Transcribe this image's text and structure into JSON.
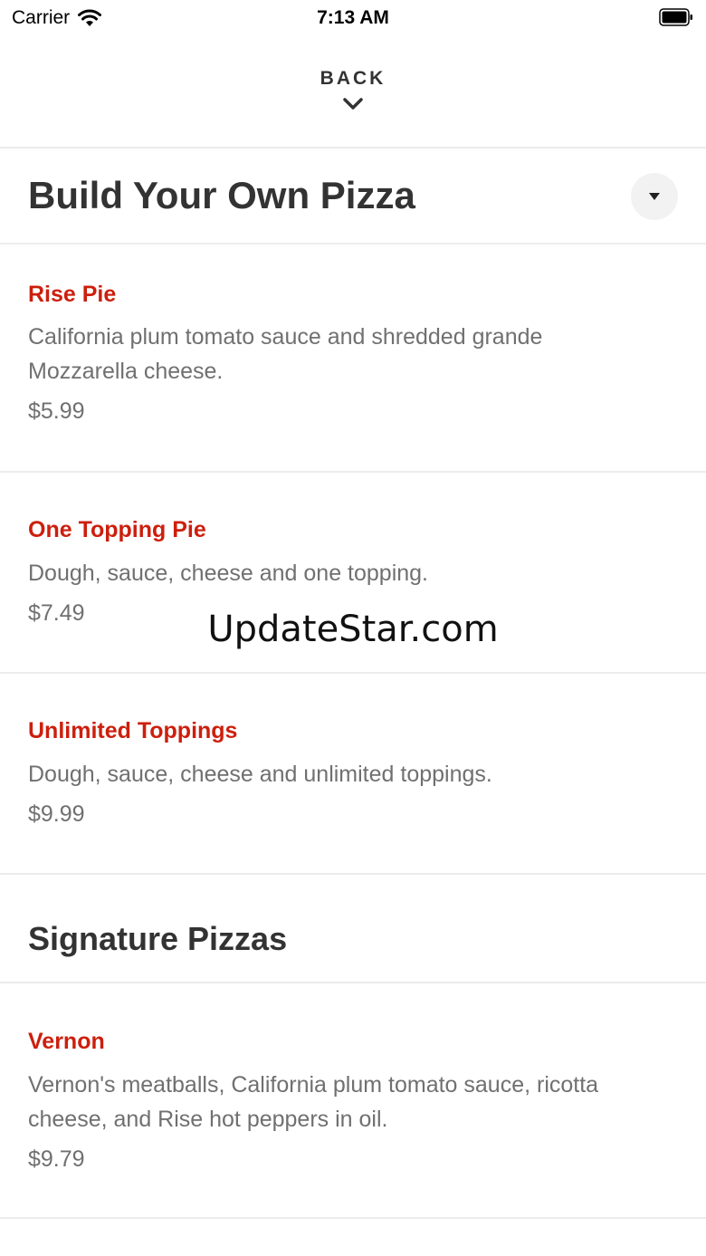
{
  "status_bar": {
    "carrier": "Carrier",
    "time": "7:13 AM"
  },
  "nav": {
    "back_label": "BACK"
  },
  "sections": [
    {
      "title": "Build Your Own Pizza",
      "items": [
        {
          "name": "Rise Pie",
          "description": "California plum tomato sauce and shredded grande Mozzarella cheese.",
          "price": "$5.99"
        },
        {
          "name": "One Topping Pie",
          "description": "Dough, sauce, cheese and one topping.",
          "price": "$7.49"
        },
        {
          "name": "Unlimited Toppings",
          "description": "Dough, sauce, cheese and unlimited toppings.",
          "price": "$9.99"
        }
      ]
    },
    {
      "title": "Signature Pizzas",
      "items": [
        {
          "name": "Vernon",
          "description": "Vernon's meatballs, California plum tomato sauce, ricotta cheese, and Rise hot peppers in oil.",
          "price": "$9.79"
        }
      ]
    }
  ],
  "watermark": "UpdateStar.com",
  "colors": {
    "item_name": "#cc1f0d",
    "text_secondary": "#707070",
    "divider": "#ececec"
  },
  "icons": {
    "wifi": "wifi-icon",
    "battery": "battery-icon",
    "back_chevron": "chevron-down-icon",
    "collapse": "caret-down-icon"
  }
}
